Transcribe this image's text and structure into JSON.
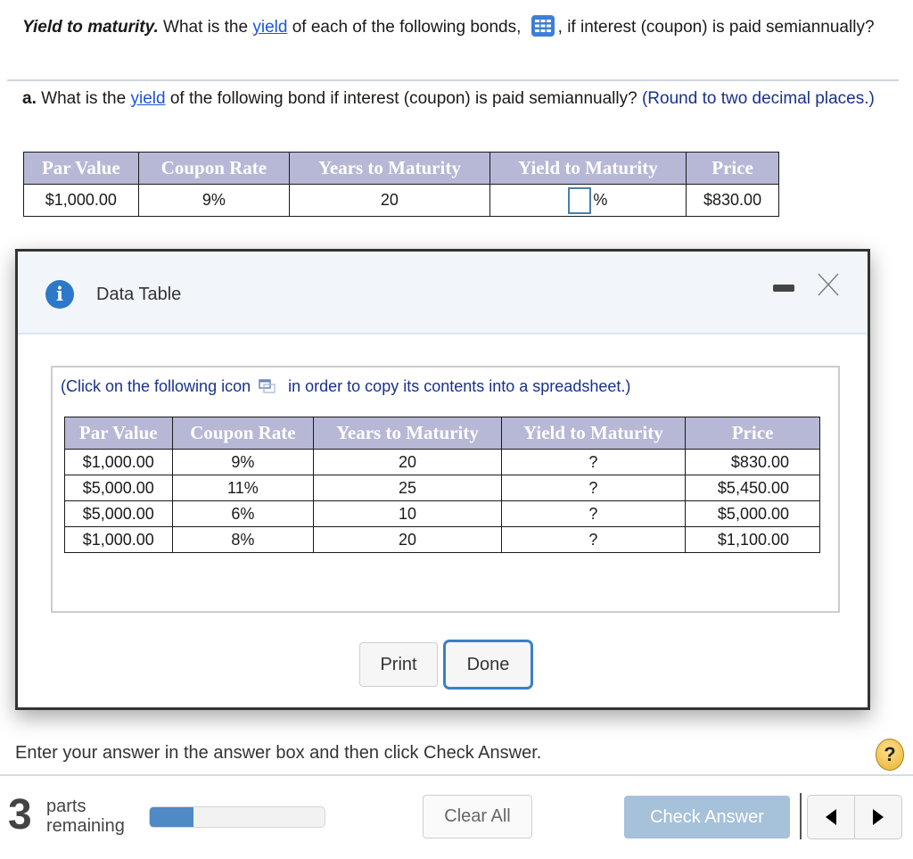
{
  "question": {
    "title": "Yield to maturity.",
    "text_1": " What is the ",
    "link_yield": "yield",
    "text_2": " of each of the following bonds, ",
    "text_3": ", if interest (coupon) is paid semiannually?",
    "grid_icon": "data-table-grid-icon"
  },
  "part_a": {
    "label": "a.",
    "text_1": " What is the ",
    "link_yield": "yield",
    "text_2": " of the following bond if interest (coupon) is paid semiannually? ",
    "hint": " (Round to two decimal places.)"
  },
  "main_table": {
    "headers": [
      "Par Value",
      "Coupon Rate",
      "Years to Maturity",
      "Yield to Maturity",
      "Price"
    ],
    "row": {
      "par_value": "$1,000.00",
      "coupon_rate": "9%",
      "years": "20",
      "yield_input_value": "",
      "yield_suffix": "%",
      "price": "$830.00"
    }
  },
  "modal": {
    "title": "Data Table",
    "info_icon": "i",
    "copy_note_1": "(Click on the following icon",
    "copy_note_2": "in order to copy its contents into a spreadsheet.)",
    "table": {
      "headers": [
        "Par Value",
        "Coupon Rate",
        "Years to Maturity",
        "Yield to Maturity",
        "Price"
      ],
      "rows": [
        {
          "par_value": "$1,000.00",
          "coupon_rate": "9%",
          "years": "20",
          "ytm": "?",
          "price": "$830.00"
        },
        {
          "par_value": "$5,000.00",
          "coupon_rate": "11%",
          "years": "25",
          "ytm": "?",
          "price": "$5,450.00"
        },
        {
          "par_value": "$5,000.00",
          "coupon_rate": "6%",
          "years": "10",
          "ytm": "?",
          "price": "$5,000.00"
        },
        {
          "par_value": "$1,000.00",
          "coupon_rate": "8%",
          "years": "20",
          "ytm": "?",
          "price": "$1,100.00"
        }
      ]
    },
    "print_label": "Print",
    "done_label": "Done"
  },
  "footer": {
    "instructions": "Enter your answer in the answer box and then click Check Answer.",
    "help_icon": "?",
    "parts_count": "3",
    "parts_label_1": "parts",
    "parts_label_2": "remaining",
    "progress_fraction": 0.25,
    "clear_all_label": "Clear All",
    "check_answer_label": "Check Answer"
  },
  "colors": {
    "link": "#1a56db",
    "hint": "#17328c",
    "table_header_bg": "#b6b8d6",
    "progress_fill": "#4f89c6",
    "check_answer_bg": "#a6c1da",
    "done_border": "#3a7fc8"
  }
}
